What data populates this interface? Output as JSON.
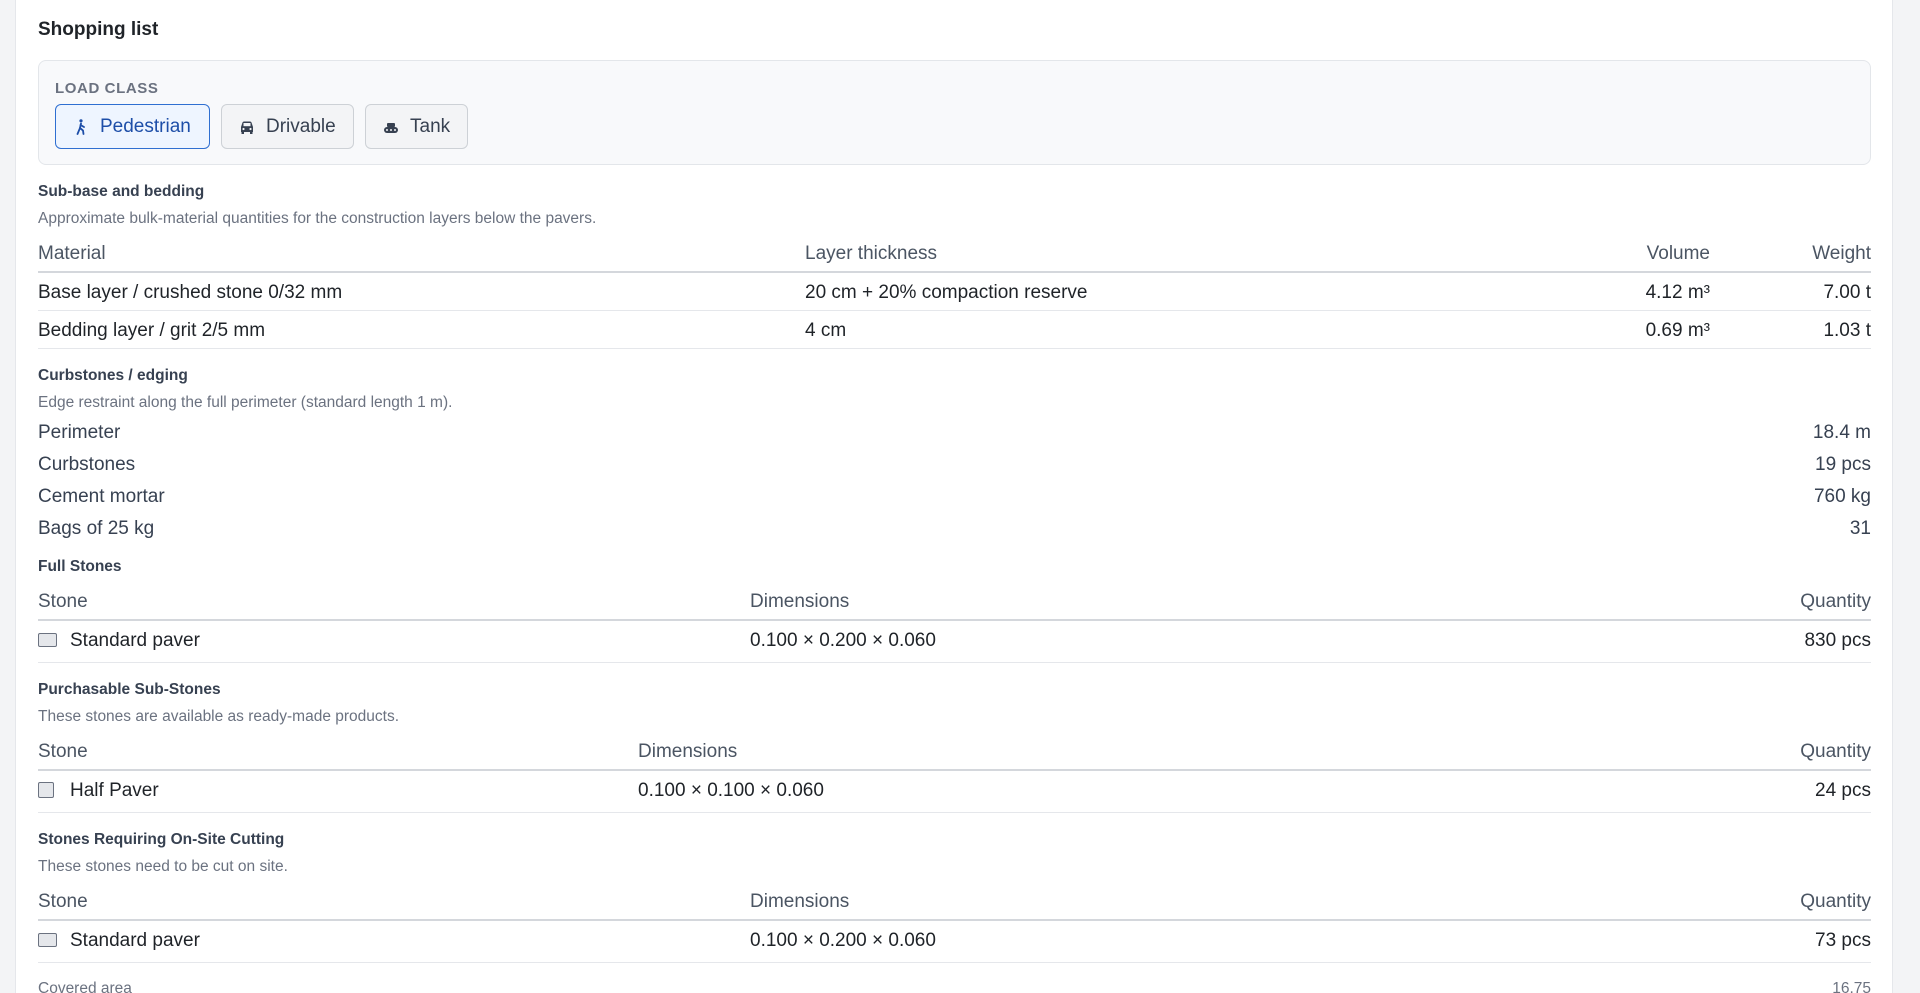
{
  "title": "Shopping list",
  "load_class": {
    "label": "LOAD CLASS",
    "options": [
      {
        "label": "Pedestrian",
        "icon": "pedestrian-icon",
        "active": true
      },
      {
        "label": "Drivable",
        "icon": "car-icon",
        "active": false
      },
      {
        "label": "Tank",
        "icon": "tank-icon",
        "active": false
      }
    ]
  },
  "subbase": {
    "title": "Sub-base and bedding",
    "desc": "Approximate bulk-material quantities for the construction layers below the pavers.",
    "headers": {
      "material": "Material",
      "thickness": "Layer thickness",
      "volume": "Volume",
      "weight": "Weight"
    },
    "rows": [
      {
        "material": "Base layer / crushed stone 0/32 mm",
        "thickness": "20 cm + 20% compaction reserve",
        "volume": "4.12 m³",
        "weight": "7.00 t"
      },
      {
        "material": "Bedding layer / grit 2/5 mm",
        "thickness": "4 cm",
        "volume": "0.69 m³",
        "weight": "1.03 t"
      }
    ]
  },
  "curbstones": {
    "title": "Curbstones / edging",
    "desc": "Edge restraint along the full perimeter (standard length 1 m).",
    "rows": [
      {
        "label": "Perimeter",
        "value": "18.4 m"
      },
      {
        "label": "Curbstones",
        "value": "19 pcs"
      },
      {
        "label": "Cement mortar",
        "value": "760 kg"
      },
      {
        "label": "Bags of 25 kg",
        "value": "31"
      }
    ]
  },
  "full_stones": {
    "title": "Full Stones",
    "headers": {
      "stone": "Stone",
      "dimensions": "Dimensions",
      "quantity": "Quantity"
    },
    "rows": [
      {
        "stone": "Standard paver",
        "dimensions": "0.100 × 0.200 × 0.060",
        "quantity": "830 pcs"
      }
    ]
  },
  "sub_stones": {
    "title": "Purchasable Sub-Stones",
    "desc": "These stones are available as ready-made products.",
    "headers": {
      "stone": "Stone",
      "dimensions": "Dimensions",
      "quantity": "Quantity"
    },
    "rows": [
      {
        "stone": "Half Paver",
        "dimensions": "0.100 × 0.100 × 0.060",
        "quantity": "24 pcs"
      }
    ]
  },
  "cut_stones": {
    "title": "Stones Requiring On-Site Cutting",
    "desc": "These stones need to be cut on site.",
    "headers": {
      "stone": "Stone",
      "dimensions": "Dimensions",
      "quantity": "Quantity"
    },
    "rows": [
      {
        "stone": "Standard paver",
        "dimensions": "0.100 × 0.200 × 0.060",
        "quantity": "73 pcs"
      }
    ]
  },
  "footer": {
    "label": "Covered area",
    "value": "16.75"
  }
}
